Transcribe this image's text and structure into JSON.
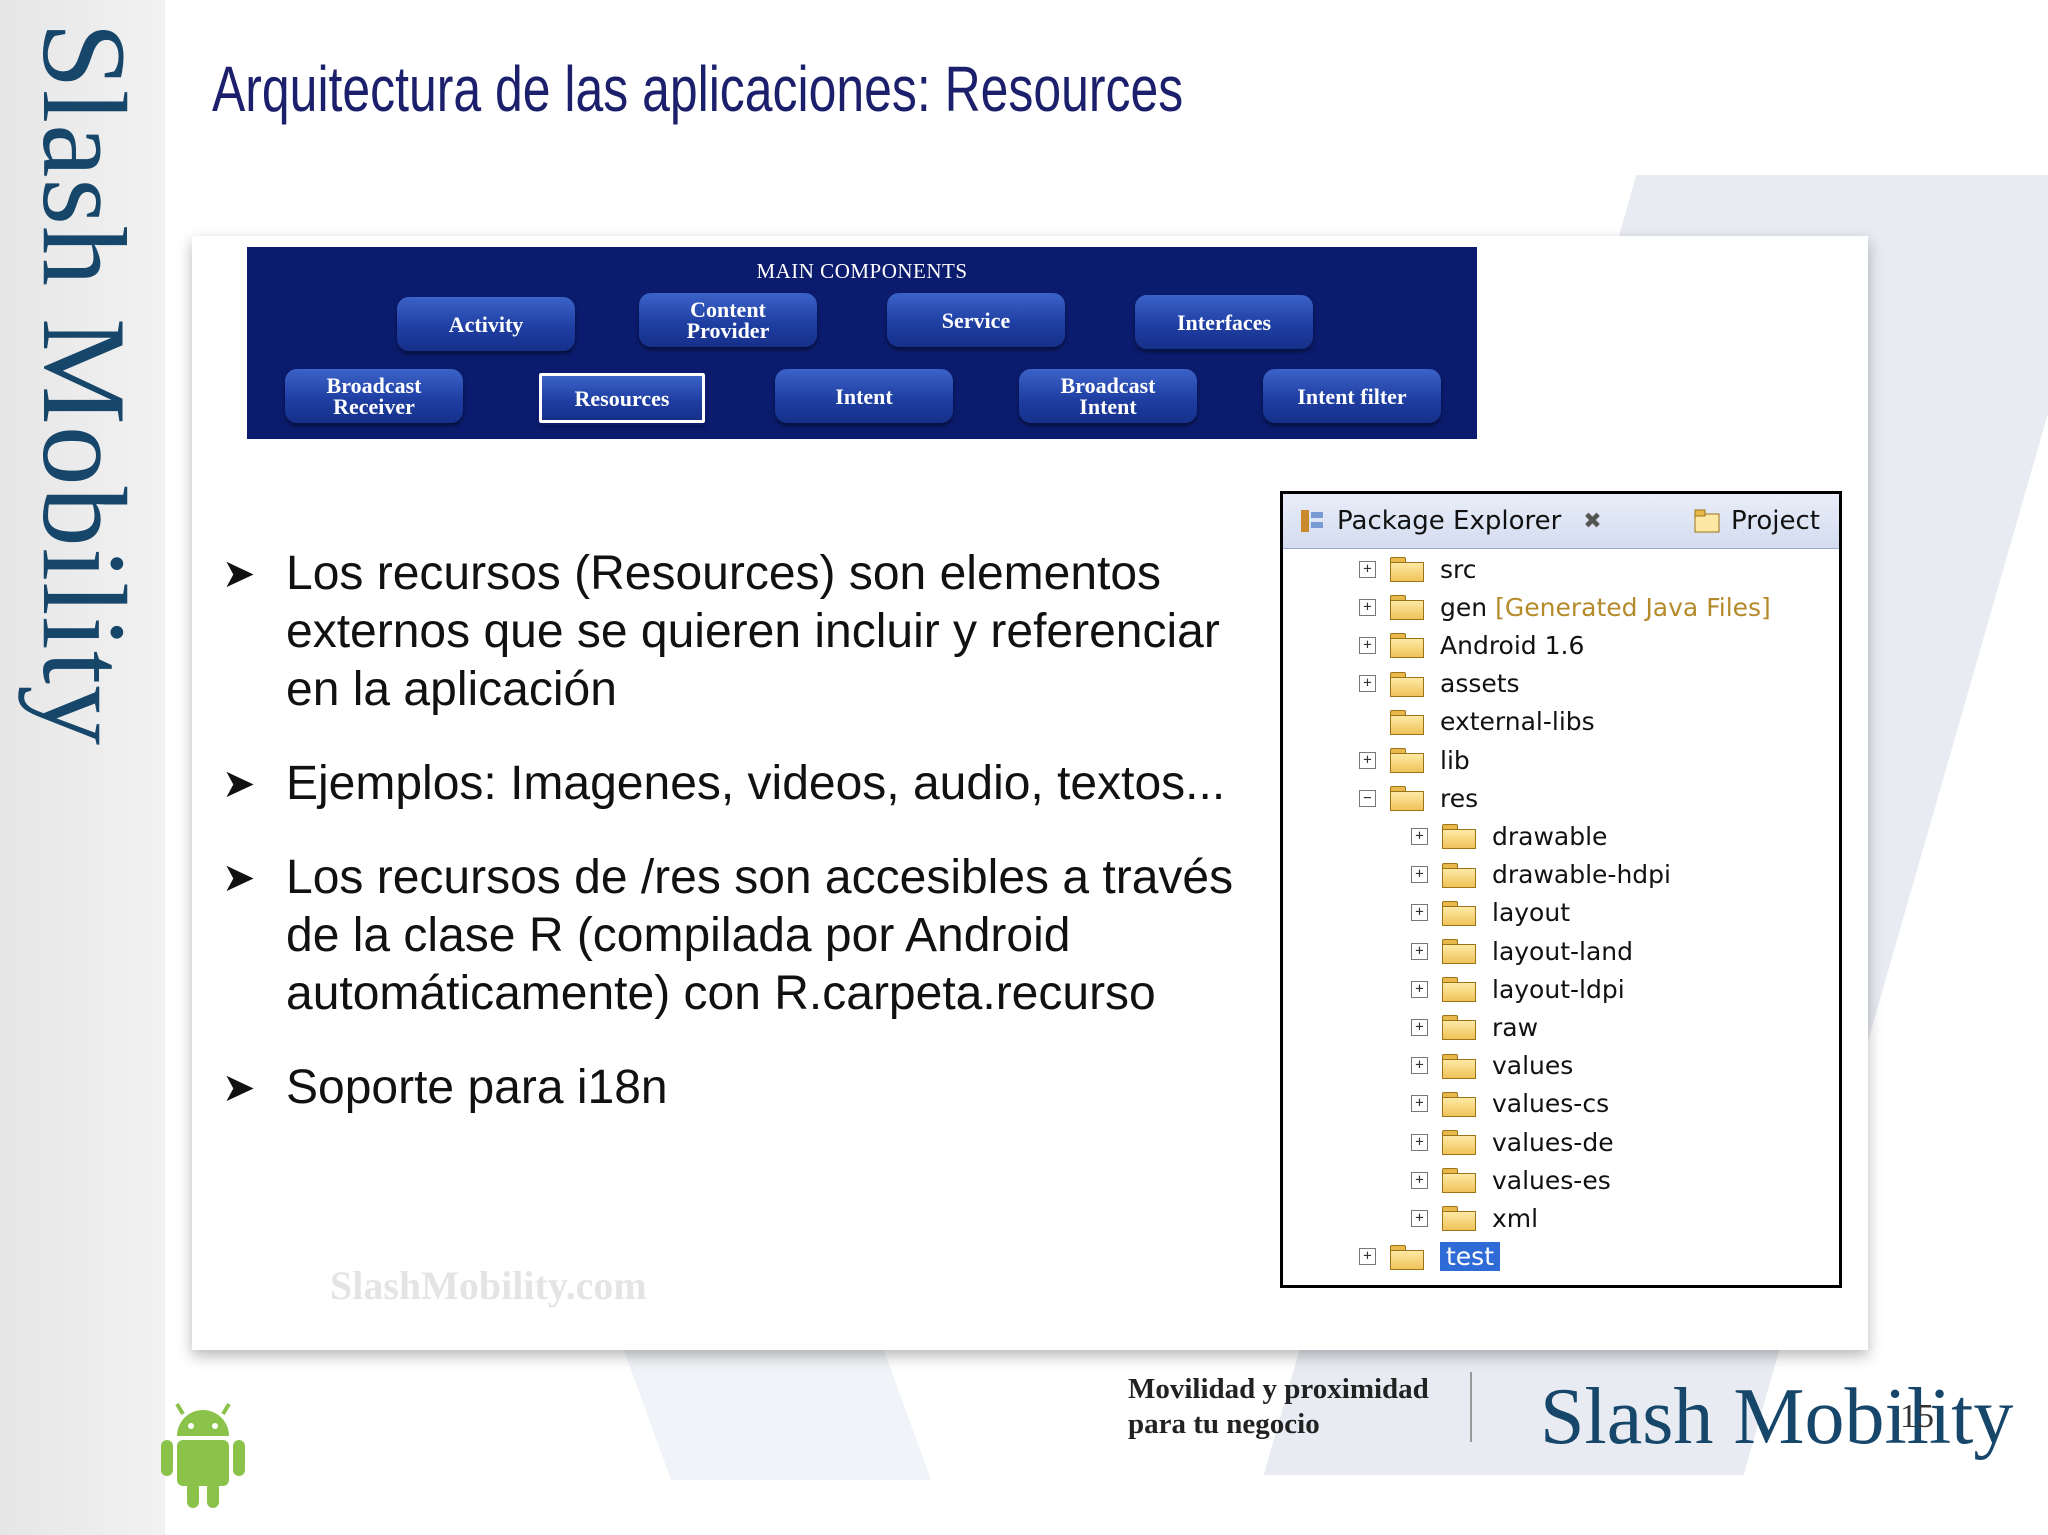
{
  "title": "Arquitectura de las aplicaciones: Resources",
  "side_brand": "Slash Mobility",
  "components": {
    "heading": "MAIN COMPONENTS",
    "row1": [
      "Activity",
      "Content\nProvider",
      "Service",
      "Interfaces"
    ],
    "row2": [
      "Broadcast\nReceiver",
      "Resources",
      "Intent",
      "Broadcast\nIntent",
      "Intent filter"
    ],
    "selected": "Resources"
  },
  "bullets": [
    "Los recursos (Resources) son elementos externos que se quieren incluir y referenciar en la aplicación",
    "Ejemplos: Imagenes, videos, audio, textos...",
    "Los recursos de /res son accesibles a través de la clase R (compilada por Android automáticamente) con R.carpeta.recurso",
    "Soporte para i18n"
  ],
  "watermark": "SlashMobility.com",
  "explorer": {
    "tab": "Package Explorer",
    "tab2": "Project",
    "items": [
      {
        "label": "src",
        "note": "",
        "level": 0,
        "expander": "+"
      },
      {
        "label": "gen",
        "note": "[Generated Java Files]",
        "level": 0,
        "expander": "+"
      },
      {
        "label": "Android 1.6",
        "note": "",
        "level": 0,
        "expander": "+"
      },
      {
        "label": "assets",
        "note": "",
        "level": 0,
        "expander": "+"
      },
      {
        "label": "external-libs",
        "note": "",
        "level": 0,
        "expander": ""
      },
      {
        "label": "lib",
        "note": "",
        "level": 0,
        "expander": "+"
      },
      {
        "label": "res",
        "note": "",
        "level": 0,
        "expander": "-"
      },
      {
        "label": "drawable",
        "note": "",
        "level": 1,
        "expander": "+"
      },
      {
        "label": "drawable-hdpi",
        "note": "",
        "level": 1,
        "expander": "+"
      },
      {
        "label": "layout",
        "note": "",
        "level": 1,
        "expander": "+"
      },
      {
        "label": "layout-land",
        "note": "",
        "level": 1,
        "expander": "+"
      },
      {
        "label": "layout-ldpi",
        "note": "",
        "level": 1,
        "expander": "+"
      },
      {
        "label": "raw",
        "note": "",
        "level": 1,
        "expander": "+"
      },
      {
        "label": "values",
        "note": "",
        "level": 1,
        "expander": "+"
      },
      {
        "label": "values-cs",
        "note": "",
        "level": 1,
        "expander": "+"
      },
      {
        "label": "values-de",
        "note": "",
        "level": 1,
        "expander": "+"
      },
      {
        "label": "values-es",
        "note": "",
        "level": 1,
        "expander": "+"
      },
      {
        "label": "xml",
        "note": "",
        "level": 1,
        "expander": "+"
      },
      {
        "label": "test",
        "note": "",
        "level": 0,
        "expander": "+",
        "selected": true
      }
    ]
  },
  "footer": {
    "tagline_line1": "Movilidad y proximidad",
    "tagline_line2": "para tu negocio",
    "brand": "Slash Mobility",
    "page_number": "15"
  },
  "colors": {
    "title": "#1c1f6b",
    "brand": "#16466a",
    "banner": "#0b1c6e",
    "selection": "#2e6bd6"
  }
}
